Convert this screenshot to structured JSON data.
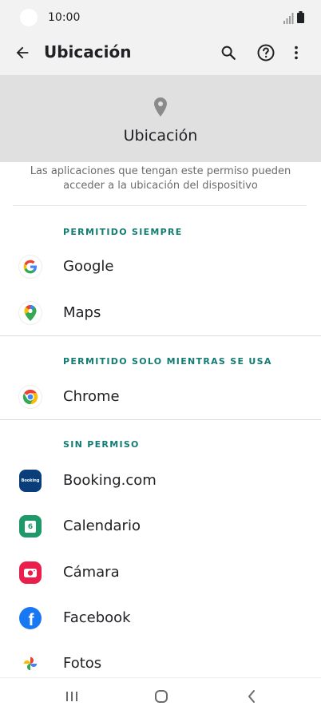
{
  "status_bar": {
    "time": "10:00"
  },
  "app_bar": {
    "title": "Ubicación"
  },
  "header": {
    "title": "Ubicación"
  },
  "description": "Las aplicaciones que tengan este permiso pueden acceder a la ubicación del dispositivo",
  "sections": [
    {
      "title": "PERMITIDO SIEMPRE",
      "apps": [
        {
          "label": "Google"
        },
        {
          "label": "Maps"
        }
      ]
    },
    {
      "title": "PERMITIDO SOLO MIENTRAS SE USA",
      "apps": [
        {
          "label": "Chrome"
        }
      ]
    },
    {
      "title": "SIN PERMISO",
      "apps": [
        {
          "label": "Booking.com",
          "icon_text": "Booking"
        },
        {
          "label": "Calendario",
          "icon_text": "6"
        },
        {
          "label": "Cámara"
        },
        {
          "label": "Facebook",
          "icon_text": "f"
        },
        {
          "label": "Fotos"
        }
      ]
    }
  ],
  "colors": {
    "accent": "#127c73",
    "booking": "#0a3e7a",
    "calendar": "#1e9a6a",
    "camera": "#e91e4a",
    "facebook": "#1877f2"
  }
}
